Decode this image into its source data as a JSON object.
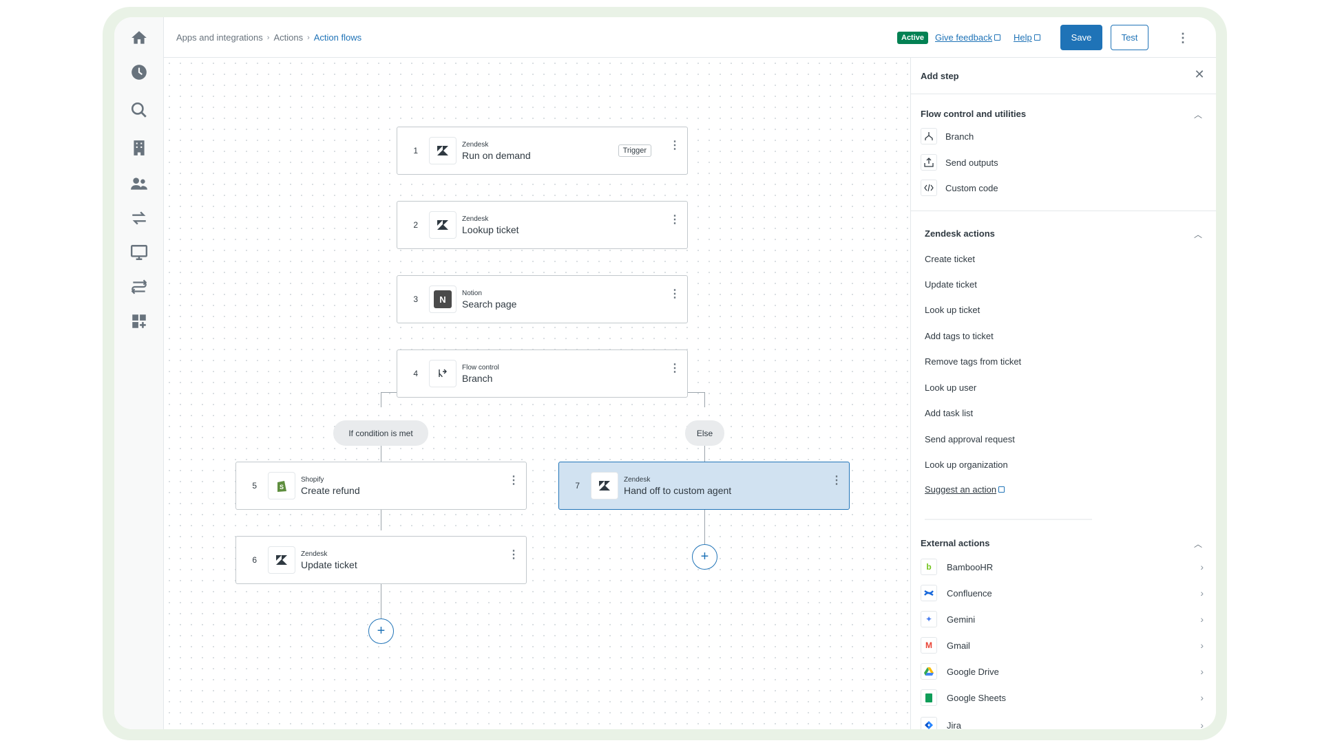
{
  "breadcrumb": {
    "items": [
      "Apps and integrations",
      "Actions"
    ],
    "current": "Action flows",
    "separator": "›"
  },
  "header": {
    "status_badge": "Active",
    "feedback_link": "Give feedback",
    "help_link": "Help",
    "save_label": "Save",
    "test_label": "Test"
  },
  "sidebar": {
    "icons": [
      "home-icon",
      "clock-icon",
      "search-icon",
      "building-icon",
      "users-icon",
      "transfer-icon",
      "monitor-icon",
      "flow-icon",
      "add-app-icon"
    ]
  },
  "flow": {
    "nodes": [
      {
        "num": "1",
        "app": "Zendesk",
        "name": "Run on demand",
        "tag": "Trigger",
        "icon": "zendesk-icon"
      },
      {
        "num": "2",
        "app": "Zendesk",
        "name": "Lookup ticket",
        "icon": "zendesk-icon"
      },
      {
        "num": "3",
        "app": "Notion",
        "name": "Search page",
        "icon": "notion-icon"
      },
      {
        "num": "4",
        "app": "Flow control",
        "name": "Branch",
        "icon": "branch-icon"
      },
      {
        "num": "5",
        "app": "Shopify",
        "name": "Create refund",
        "icon": "shopify-icon"
      },
      {
        "num": "6",
        "app": "Zendesk",
        "name": "Update ticket",
        "icon": "zendesk-icon"
      },
      {
        "num": "7",
        "app": "Zendesk",
        "name": "Hand off to custom agent",
        "icon": "zendesk-icon"
      }
    ],
    "branch_true": "If condition is met",
    "branch_false": "Else",
    "add_symbol": "+"
  },
  "panel": {
    "title": "Add step",
    "close_symbol": "✕",
    "flow_control": {
      "title": "Flow control and utilities",
      "items": [
        "Branch",
        "Send outputs",
        "Custom code"
      ]
    },
    "zendesk_actions": {
      "title": "Zendesk actions",
      "items": [
        "Create ticket",
        "Update ticket",
        "Look up ticket",
        "Add tags to ticket",
        "Remove tags from ticket",
        "Look up user",
        "Add task list",
        "Send approval request",
        "Look up organization"
      ],
      "suggest_link": "Suggest an action"
    },
    "external_actions": {
      "title": "External actions",
      "items": [
        "BambooHR",
        "Confluence",
        "Gemini",
        "Gmail",
        "Google Drive",
        "Google Sheets",
        "Jira"
      ]
    }
  },
  "colors": {
    "accent": "#1f73b7",
    "active_badge": "#038153",
    "selected_node": "#d1e2f1",
    "frame": "#e9f2e6"
  }
}
